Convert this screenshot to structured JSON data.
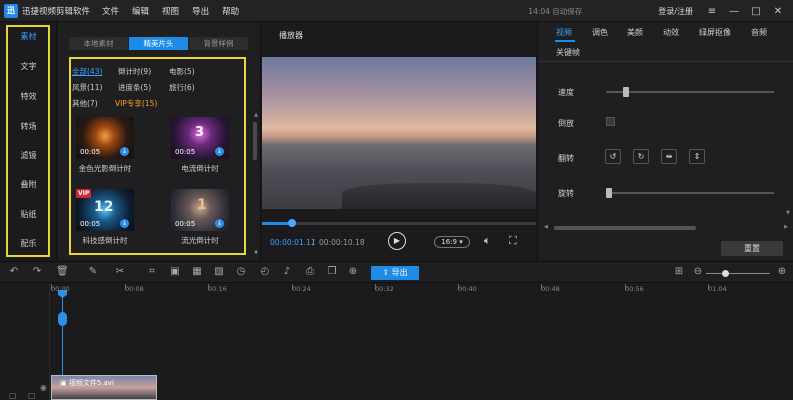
{
  "titlebar": {
    "logo": "迅",
    "app_title": "迅捷视频剪辑软件",
    "menu": [
      "文件",
      "编辑",
      "视图",
      "导出",
      "帮助"
    ],
    "autosave": "14:04 自动保存",
    "login": "登录/注册"
  },
  "left_nav": [
    "素材",
    "文字",
    "特效",
    "转场",
    "滤镜",
    "叠附",
    "贴纸",
    "配乐"
  ],
  "media": {
    "tabs": [
      "本地素材",
      "精美片头",
      "背景样例"
    ],
    "active_tab": 1,
    "categories": [
      {
        "label": "全部(43)"
      },
      {
        "label": "倒计时(9)"
      },
      {
        "label": "电影(5)"
      },
      {
        "label": "风景(11)"
      },
      {
        "label": "进度条(5)"
      },
      {
        "label": "旅行(6)"
      },
      {
        "label": "其他(7)"
      },
      {
        "label": "VIP专享(15)"
      }
    ],
    "cards": [
      {
        "duration": "00:05",
        "caption": "金色光影倒计时"
      },
      {
        "duration": "00:05",
        "caption": "电流倒计时"
      },
      {
        "duration": "00:05",
        "caption": "科技感倒计时"
      },
      {
        "duration": "00:05",
        "caption": "流光倒计时"
      }
    ],
    "card_badges": {
      "count_3": "3",
      "count_12": "12",
      "count_1": "1",
      "vip": "VIP"
    }
  },
  "player": {
    "title": "播放器",
    "current_time": "00:00:01.11",
    "separator": "/",
    "total_time": "00:00:10.18",
    "progress_fraction": 0.11,
    "ratio": "16:9"
  },
  "properties": {
    "tabs": [
      "视频",
      "调色",
      "美颜",
      "动效",
      "绿屏抠像",
      "音频",
      "关键帧"
    ],
    "rows": {
      "speed": "速度",
      "reverse": "倒放",
      "flip": "翻转",
      "rotate": "旋转"
    },
    "speed_fraction": 0.1,
    "rotate_fraction": 0.0,
    "reset": "重置"
  },
  "toolbar": {
    "export": "导出"
  },
  "timeline": {
    "ruler": [
      "00:00",
      "00:08",
      "00:16",
      "00:24",
      "00:32",
      "00:40",
      "00:48",
      "00:56",
      "01:04"
    ],
    "clip_label": "视频文件5.avi"
  },
  "colors": {
    "accent": "#1e8be6",
    "highlight_frame": "#e7d63b",
    "vip": "#ff9f22"
  }
}
